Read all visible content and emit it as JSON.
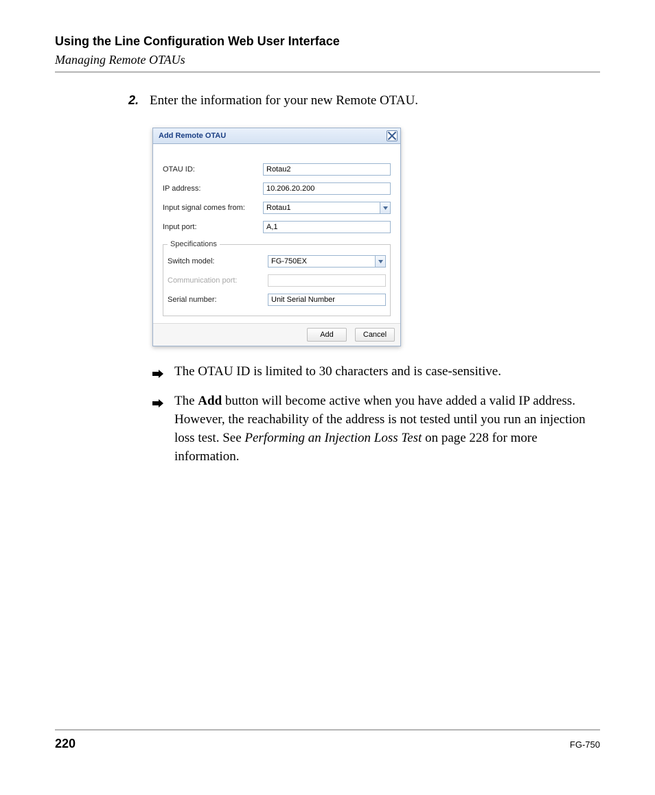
{
  "header": {
    "title": "Using the Line Configuration Web User Interface",
    "subtitle": "Managing Remote OTAUs"
  },
  "step": {
    "num": "2.",
    "text": "Enter the information for your new Remote OTAU."
  },
  "dialog": {
    "title": "Add Remote OTAU",
    "fields": {
      "otau_id": {
        "label": "OTAU ID:",
        "value": "Rotau2"
      },
      "ip": {
        "label": "IP address:",
        "value": "10.206.20.200"
      },
      "signal": {
        "label": "Input signal comes from:",
        "value": "Rotau1"
      },
      "port": {
        "label": "Input port:",
        "value": "A,1"
      }
    },
    "spec": {
      "legend": "Specifications",
      "switch_model": {
        "label": "Switch model:",
        "value": "FG-750EX"
      },
      "comm_port": {
        "label": "Communication port:",
        "value": ""
      },
      "serial": {
        "label": "Serial number:",
        "value": "Unit Serial Number"
      }
    },
    "buttons": {
      "add": "Add",
      "cancel": "Cancel"
    }
  },
  "bullets": {
    "b1": "The OTAU ID is limited to 30 characters and is case-sensitive.",
    "b2_pre": "The ",
    "b2_bold": "Add",
    "b2_mid": " button will become active when you have added a valid IP address. However, the reachability of the address is not tested until you run an injection loss test. See ",
    "b2_ital": "Performing an Injection Loss Test",
    "b2_post": " on page 228 for more information."
  },
  "footer": {
    "page": "220",
    "product": "FG-750"
  }
}
